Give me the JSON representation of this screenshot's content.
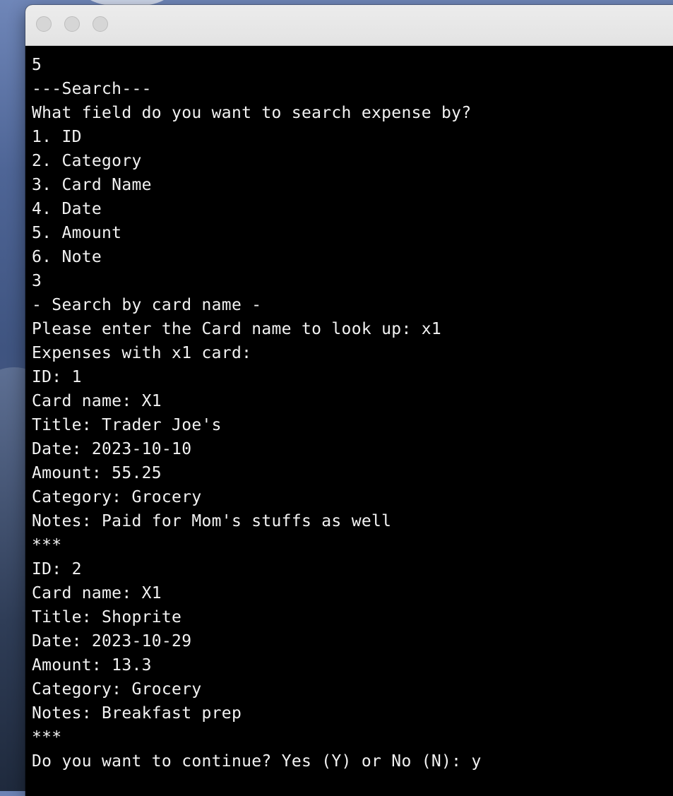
{
  "terminal": {
    "lines": [
      "5",
      "---Search---",
      "What field do you want to search expense by?",
      "1. ID",
      "2. Category",
      "3. Card Name",
      "4. Date",
      "5. Amount",
      "6. Note",
      "3",
      "- Search by card name -",
      "Please enter the Card name to look up: x1",
      "Expenses with x1 card:",
      "ID: 1",
      "Card name: X1",
      "Title: Trader Joe's",
      "Date: 2023-10-10",
      "Amount: 55.25",
      "Category: Grocery",
      "Notes: Paid for Mom's stuffs as well",
      "***",
      "ID: 2",
      "Card name: X1",
      "Title: Shoprite",
      "Date: 2023-10-29",
      "Amount: 13.3",
      "Category: Grocery",
      "Notes: Breakfast prep",
      "***",
      "Do you want to continue? Yes (Y) or No (N): y"
    ]
  },
  "window": {
    "buttons": [
      "close-icon",
      "minimize-icon",
      "zoom-icon"
    ]
  },
  "colors": {
    "terminal_background": "#000000",
    "terminal_text": "#f2f2f2",
    "titlebar": "#e8e8e8",
    "traffic_light_inactive": "#d6d6d6"
  }
}
